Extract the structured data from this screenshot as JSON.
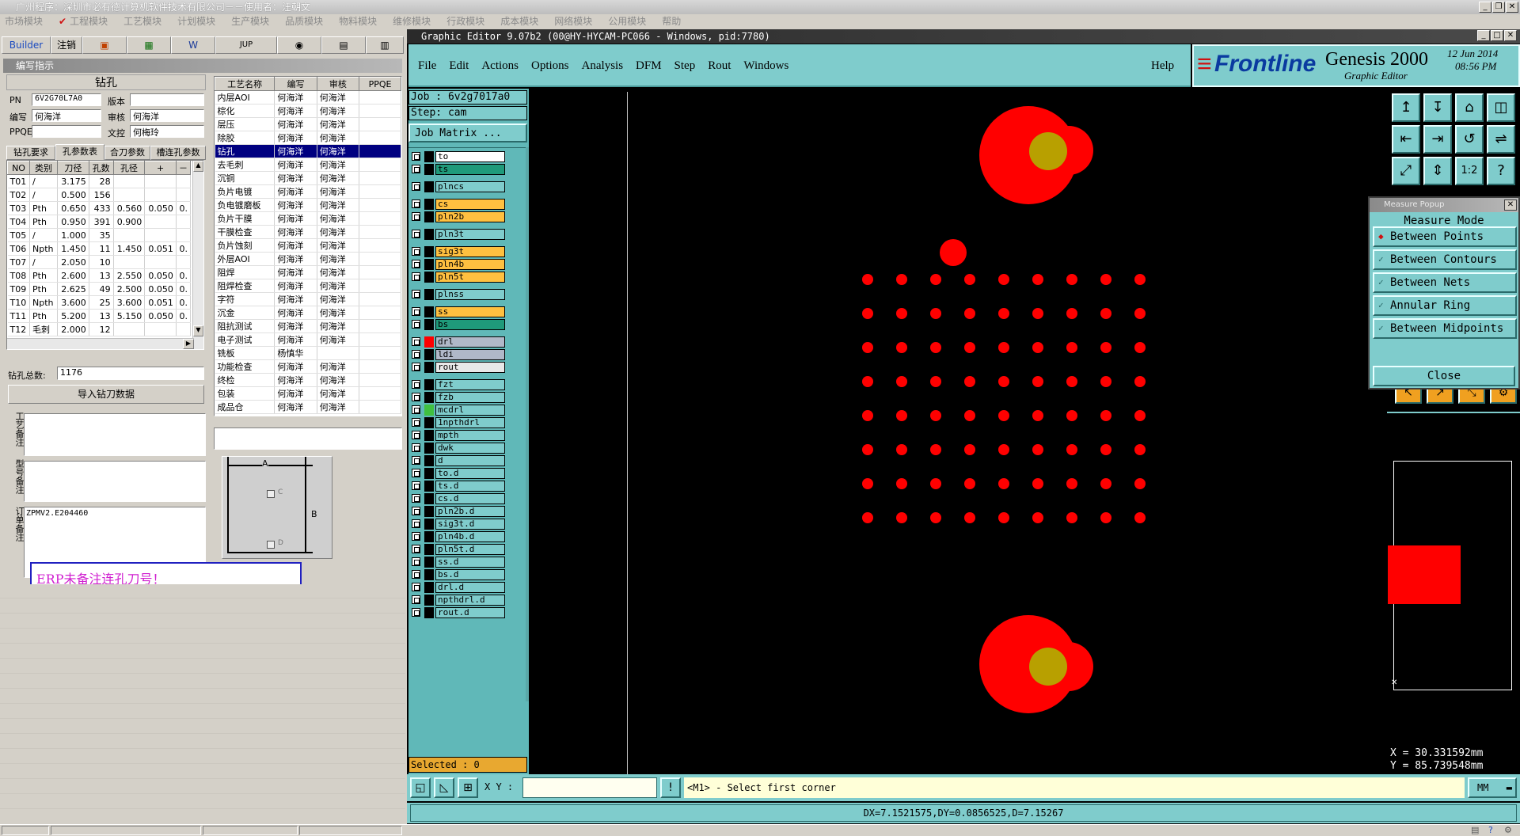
{
  "titlebar": {
    "text": "广州程序：深圳市必有德计算机软件技术有限公司－－使用者：汪朝文"
  },
  "menubar": [
    "市场模块",
    "工程模块",
    "工艺模块",
    "计划模块",
    "生产模块",
    "品质模块",
    "物料模块",
    "维修模块",
    "行政模块",
    "成本模块",
    "网络模块",
    "公用模块",
    "帮助"
  ],
  "toolbar": {
    "builder": "Builder",
    "logout": "注销",
    "jup": "JUP"
  },
  "section_header": "编写指示",
  "drill": {
    "title": "钻孔",
    "pn_label": "PN",
    "pn_value": "6V2G70L7A0",
    "version_label": "版本",
    "version_value": "",
    "writer_label": "编写",
    "writer_value": "何海洋",
    "reviewer_label": "审核",
    "reviewer_value": "何海洋",
    "ppqe_label": "PPQE",
    "ppqe_value": "",
    "control_label": "文控",
    "control_value": "何梅玲",
    "tabs": [
      "钻孔要求",
      "孔参数表",
      "合刀参数",
      "槽连孔参数"
    ],
    "columns": [
      "NO",
      "类别",
      "刀径",
      "孔数",
      "孔径",
      "+",
      "－"
    ],
    "rows": [
      [
        "T01",
        "/",
        "3.175",
        "28",
        "",
        "",
        ""
      ],
      [
        "T02",
        "/",
        "0.500",
        "156",
        "",
        "",
        ""
      ],
      [
        "T03",
        "Pth",
        "0.650",
        "433",
        "0.560",
        "0.050",
        "0."
      ],
      [
        "T04",
        "Pth",
        "0.950",
        "391",
        "0.900",
        "",
        ""
      ],
      [
        "T05",
        "/",
        "1.000",
        "35",
        "",
        "",
        ""
      ],
      [
        "T06",
        "Npth",
        "1.450",
        "11",
        "1.450",
        "0.051",
        "0."
      ],
      [
        "T07",
        "/",
        "2.050",
        "10",
        "",
        "",
        ""
      ],
      [
        "T08",
        "Pth",
        "2.600",
        "13",
        "2.550",
        "0.050",
        "0."
      ],
      [
        "T09",
        "Pth",
        "2.625",
        "49",
        "2.500",
        "0.050",
        "0."
      ],
      [
        "T10",
        "Npth",
        "3.600",
        "25",
        "3.600",
        "0.051",
        "0."
      ],
      [
        "T11",
        "Pth",
        "5.200",
        "13",
        "5.150",
        "0.050",
        "0."
      ],
      [
        "T12",
        "毛刺",
        "2.000",
        "12",
        "",
        "",
        ""
      ]
    ],
    "total_label": "钻孔总数:",
    "total_value": "1176",
    "import_button": "导入钻刀数据",
    "note_labels": [
      "工艺备注",
      "型号备注",
      "订单备注"
    ],
    "order_note": "ZPMV2.E204460",
    "alert": "ERP未备注连孔刀号！"
  },
  "process": {
    "columns": [
      "工艺名称",
      "编写",
      "审核",
      "PPQE"
    ],
    "rows": [
      [
        "内层AOI",
        "何海洋",
        "何海洋"
      ],
      [
        "棕化",
        "何海洋",
        "何海洋"
      ],
      [
        "层压",
        "何海洋",
        "何海洋"
      ],
      [
        "除胶",
        "何海洋",
        "何海洋"
      ],
      [
        "钻孔",
        "何海洋",
        "何海洋"
      ],
      [
        "去毛刺",
        "何海洋",
        "何海洋"
      ],
      [
        "沉铜",
        "何海洋",
        "何海洋"
      ],
      [
        "负片电镀",
        "何海洋",
        "何海洋"
      ],
      [
        "负电镀磨板",
        "何海洋",
        "何海洋"
      ],
      [
        "负片干膜",
        "何海洋",
        "何海洋"
      ],
      [
        "干膜检查",
        "何海洋",
        "何海洋"
      ],
      [
        "负片蚀刻",
        "何海洋",
        "何海洋"
      ],
      [
        "外层AOI",
        "何海洋",
        "何海洋"
      ],
      [
        "阻焊",
        "何海洋",
        "何海洋"
      ],
      [
        "阻焊检查",
        "何海洋",
        "何海洋"
      ],
      [
        "字符",
        "何海洋",
        "何海洋"
      ],
      [
        "沉金",
        "何海洋",
        "何海洋"
      ],
      [
        "阻抗测试",
        "何海洋",
        "何海洋"
      ],
      [
        "电子测试",
        "何海洋",
        "何海洋"
      ],
      [
        "铣板",
        "杨慎华",
        ""
      ],
      [
        "功能检查",
        "何海洋",
        "何海洋"
      ],
      [
        "终检",
        "何海洋",
        "何海洋"
      ],
      [
        "包装",
        "何海洋",
        "何海洋"
      ],
      [
        "成品仓",
        "何海洋",
        "何海洋"
      ]
    ],
    "selected_index": 4,
    "diagram": {
      "a": "A",
      "b": "B",
      "c": "C",
      "d": "D"
    }
  },
  "genesis": {
    "title": "Graphic Editor 9.07b2 (00@HY-HYCAM-PC066 - Windows, pid:7780)",
    "menu": [
      "File",
      "Edit",
      "Actions",
      "Options",
      "Analysis",
      "DFM",
      "Step",
      "Rout",
      "Windows"
    ],
    "help": "Help",
    "logo": "Frontline",
    "product": "Genesis 2000",
    "subtitle": "Graphic Editor",
    "date": "12 Jun 2014",
    "time": "08:56 PM",
    "job_label": "Job : 6v2g7017a0",
    "step_label": "Step: cam",
    "job_matrix": "Job Matrix ...",
    "layers": [
      {
        "name": "to",
        "color": "#ffffff"
      },
      {
        "name": "ts",
        "color": "#1f9a7a"
      },
      {
        "name": "plncs",
        "color": "#7fcccc"
      },
      {
        "name": "cs",
        "color": "#ffc040"
      },
      {
        "name": "pln2b",
        "color": "#ffc040"
      },
      {
        "name": "pln3t",
        "color": "#7fcccc"
      },
      {
        "name": "sig3t",
        "color": "#ffc040"
      },
      {
        "name": "pln4b",
        "color": "#ffc040"
      },
      {
        "name": "pln5t",
        "color": "#ffc040"
      },
      {
        "name": "plnss",
        "color": "#7fcccc"
      },
      {
        "name": "ss",
        "color": "#ffc040"
      },
      {
        "name": "bs",
        "color": "#1f9a7a"
      },
      {
        "name": "drl",
        "color": "#b0b8c8"
      },
      {
        "name": "ldi",
        "color": "#b0b8c8"
      },
      {
        "name": "rout",
        "color": "#e8e8e8"
      },
      {
        "name": "fzt",
        "color": "#7fcccc"
      },
      {
        "name": "fzb",
        "color": "#7fcccc"
      },
      {
        "name": "mcdrl",
        "color": "#7fcccc"
      },
      {
        "name": "1npthdrl",
        "color": "#7fcccc"
      },
      {
        "name": "mpth",
        "color": "#7fcccc"
      },
      {
        "name": "dwk",
        "color": "#7fcccc"
      },
      {
        "name": "d",
        "color": "#7fcccc"
      },
      {
        "name": "to.d",
        "color": "#7fcccc"
      },
      {
        "name": "ts.d",
        "color": "#7fcccc"
      },
      {
        "name": "cs.d",
        "color": "#7fcccc"
      },
      {
        "name": "pln2b.d",
        "color": "#7fcccc"
      },
      {
        "name": "sig3t.d",
        "color": "#7fcccc"
      },
      {
        "name": "pln4b.d",
        "color": "#7fcccc"
      },
      {
        "name": "pln5t.d",
        "color": "#7fcccc"
      },
      {
        "name": "ss.d",
        "color": "#7fcccc"
      },
      {
        "name": "bs.d",
        "color": "#7fcccc"
      },
      {
        "name": "drl.d",
        "color": "#7fcccc"
      },
      {
        "name": "npthdrl.d",
        "color": "#7fcccc"
      },
      {
        "name": "rout.d",
        "color": "#7fcccc"
      }
    ],
    "selected": "Selected : 0",
    "xy_label": "X Y :",
    "prompt": "<M1> - Select first corner",
    "units": "MM",
    "measure_result": "DX=7.1521575,DY=0.0856525,D=7.15267",
    "coords": {
      "x": "X = 30.331592mm",
      "y": "Y = 85.739548mm"
    },
    "tools": [
      "↥",
      "↧",
      "⌂",
      "◫",
      "⇤",
      "⇥",
      "↺",
      "⇌",
      "⤢",
      "⇕",
      "1:2",
      "?"
    ],
    "popup": {
      "title": "Measure Popup",
      "mode_label": "Measure Mode",
      "options": [
        "Between Points",
        "Between Contours",
        "Between Nets",
        "Annular Ring",
        "Between Midpoints"
      ],
      "selected": 0,
      "close": "Close"
    },
    "colors": {
      "pad": "#ff0000",
      "overlap": "#b8a000",
      "panel": "#7fcccc"
    }
  }
}
